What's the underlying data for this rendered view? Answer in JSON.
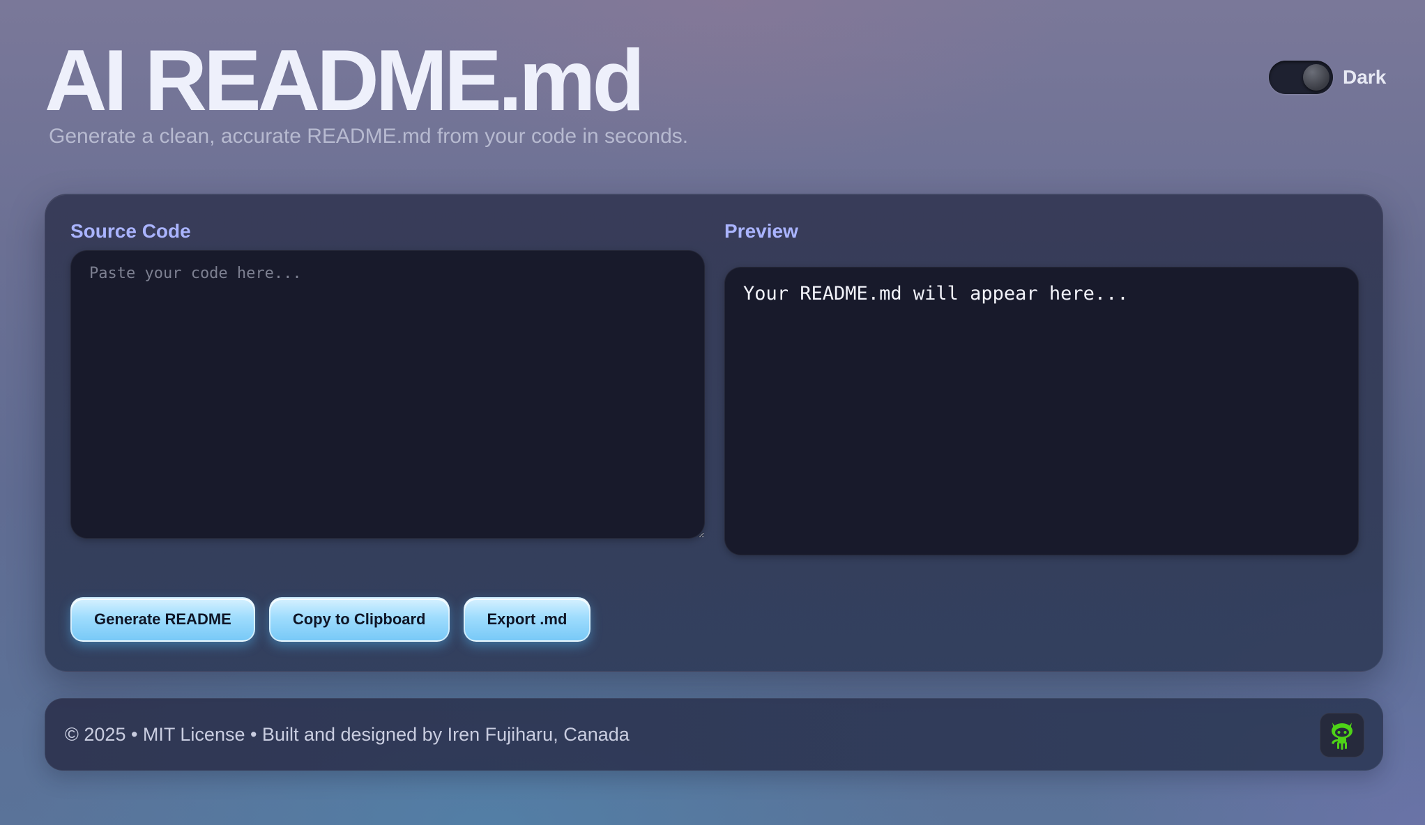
{
  "header": {
    "title": "AI README.md",
    "subtitle": "Generate a clean, accurate README.md from your code in seconds."
  },
  "theme_toggle": {
    "label": "Dark",
    "state": "on"
  },
  "main": {
    "source_label": "Source Code",
    "source_placeholder": "Paste your code here...",
    "source_value": "",
    "preview_label": "Preview",
    "preview_text": "Your README.md will appear here..."
  },
  "actions": {
    "generate_label": "Generate README",
    "copy_label": "Copy to Clipboard",
    "export_label": "Export .md"
  },
  "footer": {
    "text": "© 2025 • MIT License • Built and designed by Iren Fujiharu, Canada",
    "github_icon": "github-octocat-icon"
  },
  "colors": {
    "accent": "#aab4ff",
    "button": "#9fdcfd",
    "github_icon": "#4ed317",
    "panel_bg": "#181a2b"
  }
}
